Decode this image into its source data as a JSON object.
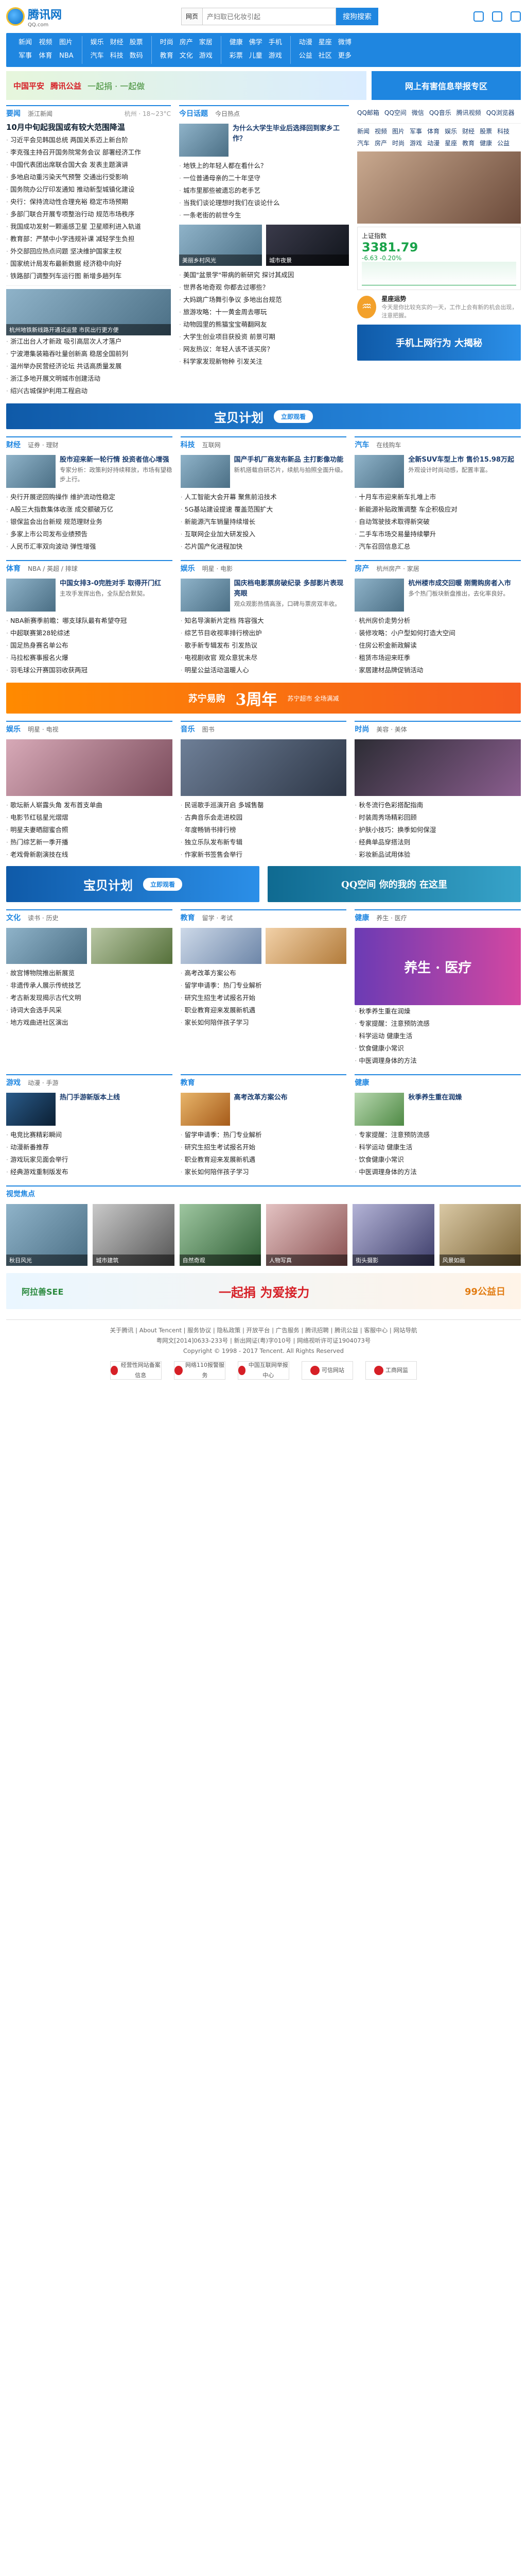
{
  "brand": {
    "logo_text": "腾讯网",
    "logo_sub": "QQ.com"
  },
  "search": {
    "scope": "网页",
    "placeholder": "产妇取已化妆引起",
    "button": "搜狗搜索"
  },
  "nav": [
    [
      "新闻",
      "视频",
      "图片",
      "军事",
      "体育",
      "NBA"
    ],
    [
      "娱乐",
      "财经",
      "股票",
      "汽车",
      "科技",
      "数码"
    ],
    [
      "时尚",
      "房产",
      "家居",
      "教育",
      "文化",
      "游戏"
    ],
    [
      "健康",
      "佛学",
      "手机",
      "彩票",
      "儿童",
      "游戏"
    ],
    [
      "动漫",
      "星座",
      "微博",
      "公益",
      "社区",
      "更多"
    ]
  ],
  "banner": {
    "brand": "中国平安",
    "sub": "腾讯公益",
    "slogan": "一起捐 · 一起做",
    "right": "网上有害信息举报专区"
  },
  "news": {
    "head": "要闻",
    "sub": "浙江新闻",
    "weather": "杭州 · 18~23°C",
    "headline": "10月中旬起我国或有较大范围降温",
    "items": [
      "习近平会见韩国总统 两国关系迈上新台阶",
      "李克强主持召开国务院常务会议 部署经济工作",
      "中国代表团出席联合国大会 发表主题演讲",
      "多地启动重污染天气预警 交通出行受影响",
      "国务院办公厅印发通知 推动新型城镇化建设",
      "央行：保持流动性合理充裕 稳定市场预期",
      "多部门联合开展专项整治行动 规范市场秩序",
      "我国成功发射一颗遥感卫星 卫星顺利进入轨道",
      "教育部：严禁中小学违规补课 减轻学生负担",
      "外交部回应热点问题 坚决维护国家主权",
      "国家统计局发布最新数据 经济稳中向好",
      "铁路部门调整列车运行图 新增多趟列车"
    ],
    "zj_items": [
      "杭州地铁新线路开通试运营 市民出行更方便",
      "浙江出台人才新政 吸引高层次人才落户",
      "宁波港集装箱吞吐量创新高 稳居全国前列",
      "温州举办民营经济论坛 共话高质量发展",
      "浙江多地开展文明城市创建活动",
      "绍兴古城保护利用工程启动"
    ]
  },
  "today": {
    "head": "今日话题",
    "sub": "今日热点",
    "top": "为什么大学生毕业后选择回到家乡工作？",
    "items": [
      "地铁上的年轻人都在看什么？",
      "一位普通母亲的二十年坚守",
      "城市里那些被遗忘的老手艺",
      "当我们谈论理想时我们在谈论什么",
      "一条老街的前世今生"
    ],
    "pics": [
      {
        "cap": "美丽乡村风光"
      },
      {
        "cap": "城市夜景"
      }
    ],
    "list": [
      "美国\"盆景学\"带病的新研究 探讨其成因",
      "世界各地奇观 你都去过哪些？",
      "大妈跳广场舞引争议 多地出台规范",
      "旅游攻略：十一黄金周去哪玩",
      "动物园里的熊猫宝宝萌翻网友",
      "大学生创业项目获投资 前景可期",
      "网友热议：年轻人该不该买房？",
      "科学家发现新物种 引发关注"
    ]
  },
  "right_col": {
    "qq": [
      "QQ邮箱",
      "QQ空间",
      "微信",
      "QQ音乐",
      "腾讯视频",
      "QQ浏览器"
    ],
    "links": [
      [
        "新闻",
        "视频",
        "图片",
        "军事",
        "体育",
        "娱乐"
      ],
      [
        "财经",
        "股票",
        "科技",
        "汽车",
        "房产",
        "时尚"
      ],
      [
        "游戏",
        "动漫",
        "星座",
        "教育",
        "健康",
        "公益"
      ]
    ],
    "stock_title": "上证指数",
    "stock_val": "3381.79",
    "stock_chg": "-6.63 -0.20%",
    "horo_name": "星座运势",
    "horo_sign": "♒",
    "horo_text": "今天是你比较充实的一天，工作上会有新的机会出现，注意把握。",
    "promo": "手机上网行为 大揭秘"
  },
  "videoad": {
    "big": "宝贝计划",
    "btn": "立即观看"
  },
  "finance": {
    "head": "财经",
    "sub": "证券 · 理财",
    "card_t": "股市迎来新一轮行情 投资者信心增强",
    "card_d": "专家分析：政策利好持续释放，市场有望稳步上行。",
    "items": [
      "央行开展逆回购操作 维护流动性稳定",
      "A股三大指数集体收涨 成交额破万亿",
      "银保监会出台新规 规范理财业务",
      "多家上市公司发布业绩预告",
      "人民币汇率双向波动 弹性增强"
    ]
  },
  "tech": {
    "head": "科技",
    "sub": "互联网",
    "card_t": "国产手机厂商发布新品 主打影像功能",
    "card_d": "新机搭载自研芯片，续航与拍照全面升级。",
    "items": [
      "人工智能大会开幕 聚焦前沿技术",
      "5G基站建设提速 覆盖范围扩大",
      "新能源汽车销量持续增长",
      "互联网企业加大研发投入",
      "芯片国产化进程加快"
    ]
  },
  "auto": {
    "head": "汽车",
    "sub": "在线购车",
    "card_t": "全新SUV车型上市 售价15.98万起",
    "card_d": "外观设计时尚动感，配置丰富。",
    "items": [
      "十月车市迎来新车扎堆上市",
      "新能源补贴政策调整 车企积极应对",
      "自动驾驶技术取得新突破",
      "二手车市场交易量持续攀升",
      "汽车召回信息汇总"
    ]
  },
  "sports": {
    "head": "体育",
    "sub": "NBA / 英超 / 排球",
    "card_t": "中国女排3-0完胜对手 取得开门红",
    "card_d": "主攻手发挥出色，全队配合默契。",
    "items": [
      "NBA新赛季前瞻：哪支球队最有希望夺冠",
      "中超联赛第28轮综述",
      "国足热身赛名单公布",
      "马拉松赛事报名火爆",
      "羽毛球公开赛国羽收获两冠"
    ]
  },
  "ent": {
    "head": "娱乐",
    "sub": "明星 · 电影",
    "card_t": "国庆档电影票房破纪录 多部影片表现亮眼",
    "card_d": "观众观影热情高涨，口碑与票房双丰收。",
    "items": [
      "知名导演新片定档 阵容强大",
      "综艺节目收视率排行榜出炉",
      "歌手新专辑发布 引发热议",
      "电视剧收官 观众意犹未尽",
      "明星公益活动温暖人心"
    ]
  },
  "house": {
    "head": "房产",
    "sub": "杭州房产 · 家居",
    "card_t": "杭州楼市成交回暖 刚需购房者入市",
    "card_d": "多个热门板块新盘推出，去化率良好。",
    "items": [
      "杭州房价走势分析",
      "装修攻略：小户型如何打造大空间",
      "住房公积金新政解读",
      "租赁市场迎来旺季",
      "家居建材品牌促销活动"
    ]
  },
  "suning": {
    "brand": "苏宁易购",
    "big": "3周年",
    "sub": "苏宁超市 全场满减"
  },
  "fun": {
    "head": "娱乐",
    "sub": "明星 · 电视",
    "items": [
      "歌坛新人崭露头角 发布首支单曲",
      "电影节红毯星光熠熠",
      "明星夫妻晒甜蜜合照",
      "热门综艺新一季开播",
      "老戏骨新剧演技在线"
    ]
  },
  "music": {
    "head": "音乐",
    "sub": "图书",
    "items": [
      "民谣歌手巡演开启 多城售罄",
      "古典音乐会走进校园",
      "年度畅销书排行榜",
      "独立乐队发布新专辑",
      "作家新书签售会举行"
    ]
  },
  "fashion": {
    "head": "时尚",
    "sub": "美容 · 美体",
    "items": [
      "秋冬流行色彩搭配指南",
      "时装周秀场精彩回顾",
      "护肤小技巧：换季如何保湿",
      "经典单品穿搭法则",
      "彩妆新品试用体验"
    ]
  },
  "video2": {
    "big": "宝贝计划",
    "btn": "立即观看",
    "right": "QQ空间 你的我的 在这里"
  },
  "culture": {
    "head": "文化",
    "sub": "读书 · 历史",
    "items": [
      "故宫博物院推出新展览",
      "非遗传承人展示传统技艺",
      "考古新发现揭示古代文明",
      "诗词大会选手风采",
      "地方戏曲进社区演出"
    ]
  },
  "edu": {
    "head": "教育",
    "sub": "留学 · 考试",
    "items": [
      "高考改革方案公布",
      "留学申请季：热门专业解析",
      "研究生招生考试报名开始",
      "职业教育迎来发展新机遇",
      "家长如何陪伴孩子学习"
    ]
  },
  "health": {
    "head": "健康",
    "sub": "养生 · 医疗",
    "items": [
      "秋季养生重在润燥",
      "专家提醒：注意预防流感",
      "科学运动 健康生活",
      "饮食健康小常识",
      "中医调理身体的方法"
    ]
  },
  "games": {
    "head": "游戏",
    "sub": "动漫 · 手游",
    "items": [
      "热门手游新版本上线",
      "电竞比赛精彩瞬间",
      "动漫新番推荐",
      "游戏玩家见面会举行",
      "经典游戏重制版发布"
    ]
  },
  "photo": {
    "head": "视觉焦点",
    "caps": [
      "秋日风光",
      "城市建筑",
      "自然奇观",
      "人物写真",
      "街头摄影",
      "风景如画"
    ]
  },
  "bottom_ad": {
    "left": "阿拉善SEE",
    "mid": "一起捐 为爱接力",
    "right": "99公益日"
  },
  "footer": {
    "links": "关于腾讯 | About Tencent | 服务协议 | 隐私政策 | 开放平台 | 广告服务 | 腾讯招聘 | 腾讯公益 | 客服中心 | 网站导航",
    "copy": "Copyright © 1998 - 2017 Tencent. All Rights Reserved",
    "icp": "粤网文[2014]0633-233号 | 新出网证(粤)字010号 | 网络视听许可证1904073号",
    "badges": [
      "经营性网站备案信息",
      "网络110报警服务",
      "中国互联网举报中心",
      "可信网站",
      "工商网监"
    ]
  },
  "colors": {
    "primary": "#1f86e0",
    "green": "#1aa34a",
    "red": "#d61f26"
  }
}
